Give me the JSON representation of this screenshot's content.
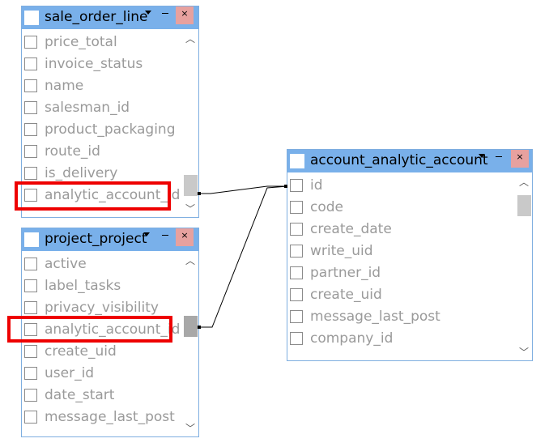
{
  "tables": {
    "sale_order_line": {
      "title": "sale_order_line",
      "dropdown_glyph": "▾",
      "close_glyph": "×",
      "fields": [
        "price_total",
        "invoice_status",
        "name",
        "salesman_id",
        "product_packaging",
        "route_id",
        "is_delivery",
        "analytic_account_id"
      ],
      "highlighted_field": "analytic_account_id"
    },
    "project_project": {
      "title": "project_project",
      "dropdown_glyph": "▾",
      "close_glyph": "×",
      "fields": [
        "active",
        "label_tasks",
        "privacy_visibility",
        "analytic_account_id",
        "create_uid",
        "user_id",
        "date_start",
        "message_last_post"
      ],
      "highlighted_field": "analytic_account_id"
    },
    "account_analytic_account": {
      "title": "account_analytic_account",
      "dropdown_glyph": "▾",
      "close_glyph": "×",
      "fields": [
        "id",
        "code",
        "create_date",
        "write_uid",
        "partner_id",
        "create_uid",
        "message_last_post",
        "company_id"
      ]
    }
  },
  "scroll_glyphs": {
    "up": "︿",
    "down": "﹀"
  },
  "colors": {
    "title_bar": "#79b0ea",
    "close_button": "#e7a19f",
    "highlight_border": "#ee0000",
    "field_text": "#9a9a9a",
    "connector": "#000000"
  },
  "connectors": [
    {
      "from": "sale_order_line.analytic_account_id",
      "to": "account_analytic_account.id"
    },
    {
      "from": "project_project.analytic_account_id",
      "to": "account_analytic_account.id"
    }
  ]
}
